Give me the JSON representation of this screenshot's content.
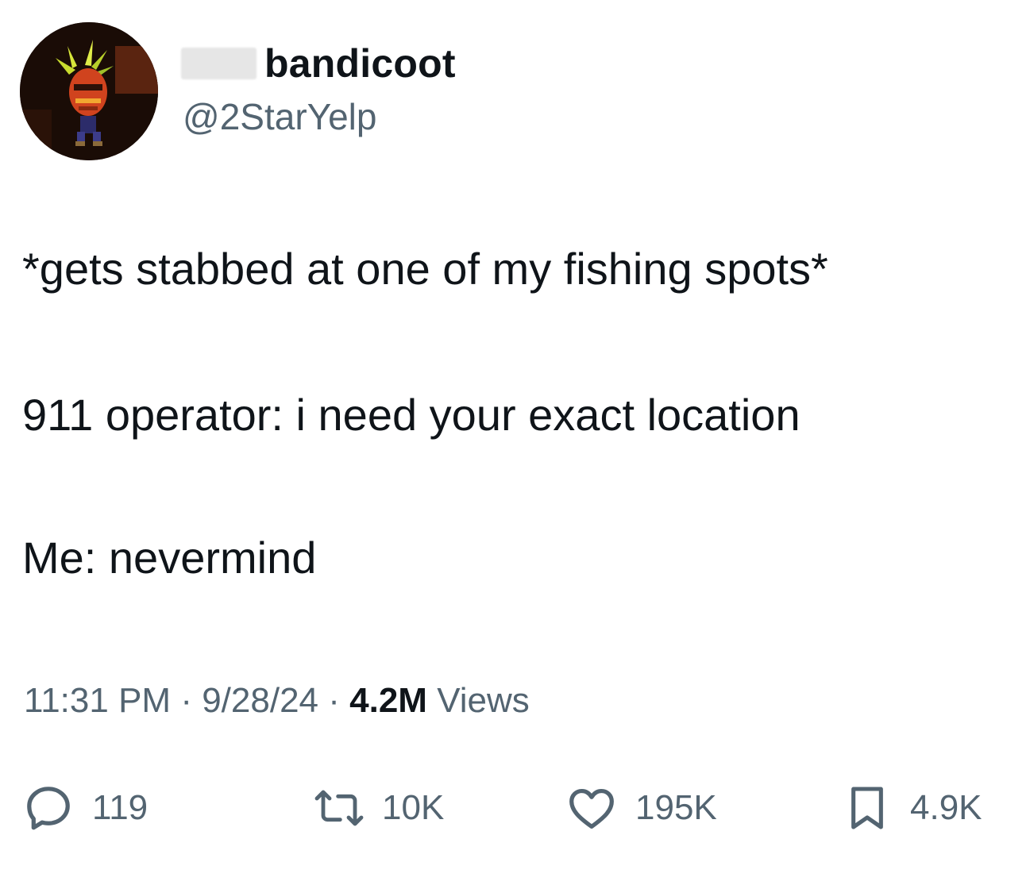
{
  "user": {
    "display_name": "bandicoot",
    "handle": "@2StarYelp",
    "avatar_icon": "bandicoot-avatar"
  },
  "tweet": {
    "lines": [
      "*gets stabbed at one of my fishing spots*",
      "911 operator: i need your exact location",
      "Me: nevermind"
    ]
  },
  "meta": {
    "time": "11:31 PM",
    "separator": "·",
    "date": "9/28/24",
    "views_count": "4.2M",
    "views_label": "Views"
  },
  "actions": {
    "replies": "119",
    "retweets": "10K",
    "likes": "195K",
    "bookmarks": "4.9K"
  },
  "colors": {
    "text": "#0f1419",
    "secondary": "#536471",
    "background": "#ffffff"
  }
}
